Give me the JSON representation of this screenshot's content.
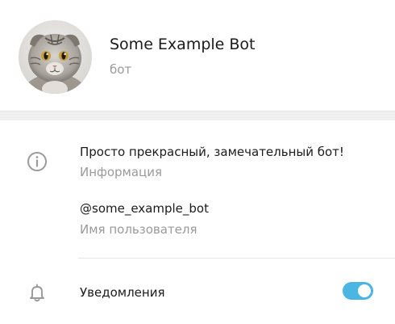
{
  "profile": {
    "name": "Some Example Bot",
    "subtitle": "бот"
  },
  "about": {
    "text": "Просто прекрасный, замечательный бот!",
    "label": "Информация"
  },
  "username": {
    "value": "@some_example_bot",
    "label": "Имя пользователя"
  },
  "notifications": {
    "label": "Уведомления",
    "enabled": true
  },
  "colors": {
    "accent": "#4bb5e4",
    "secondary_text": "#9a9a9a",
    "primary_text": "#1b1b1b"
  },
  "icons": {
    "about": "info-icon",
    "notifications": "bell-icon"
  }
}
